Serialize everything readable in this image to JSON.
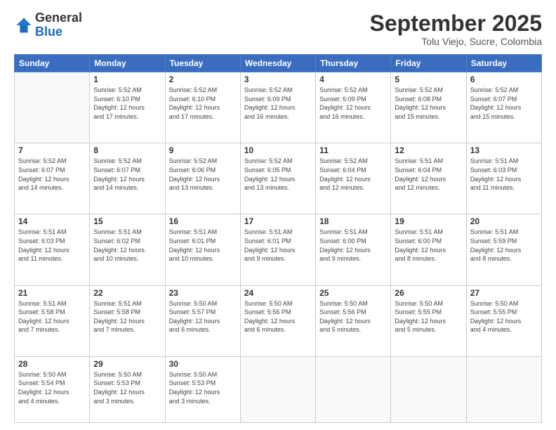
{
  "header": {
    "logo_general": "General",
    "logo_blue": "Blue",
    "month_title": "September 2025",
    "subtitle": "Tolu Viejo, Sucre, Colombia"
  },
  "weekdays": [
    "Sunday",
    "Monday",
    "Tuesday",
    "Wednesday",
    "Thursday",
    "Friday",
    "Saturday"
  ],
  "weeks": [
    [
      {
        "day": "",
        "info": ""
      },
      {
        "day": "1",
        "info": "Sunrise: 5:52 AM\nSunset: 6:10 PM\nDaylight: 12 hours\nand 17 minutes."
      },
      {
        "day": "2",
        "info": "Sunrise: 5:52 AM\nSunset: 6:10 PM\nDaylight: 12 hours\nand 17 minutes."
      },
      {
        "day": "3",
        "info": "Sunrise: 5:52 AM\nSunset: 6:09 PM\nDaylight: 12 hours\nand 16 minutes."
      },
      {
        "day": "4",
        "info": "Sunrise: 5:52 AM\nSunset: 6:09 PM\nDaylight: 12 hours\nand 16 minutes."
      },
      {
        "day": "5",
        "info": "Sunrise: 5:52 AM\nSunset: 6:08 PM\nDaylight: 12 hours\nand 15 minutes."
      },
      {
        "day": "6",
        "info": "Sunrise: 5:52 AM\nSunset: 6:07 PM\nDaylight: 12 hours\nand 15 minutes."
      }
    ],
    [
      {
        "day": "7",
        "info": ""
      },
      {
        "day": "8",
        "info": "Sunrise: 5:52 AM\nSunset: 6:07 PM\nDaylight: 12 hours\nand 14 minutes."
      },
      {
        "day": "9",
        "info": "Sunrise: 5:52 AM\nSunset: 6:06 PM\nDaylight: 12 hours\nand 13 minutes."
      },
      {
        "day": "10",
        "info": "Sunrise: 5:52 AM\nSunset: 6:05 PM\nDaylight: 12 hours\nand 13 minutes."
      },
      {
        "day": "11",
        "info": "Sunrise: 5:52 AM\nSunset: 6:04 PM\nDaylight: 12 hours\nand 12 minutes."
      },
      {
        "day": "12",
        "info": "Sunrise: 5:51 AM\nSunset: 6:04 PM\nDaylight: 12 hours\nand 12 minutes."
      },
      {
        "day": "13",
        "info": "Sunrise: 5:51 AM\nSunset: 6:03 PM\nDaylight: 12 hours\nand 11 minutes."
      }
    ],
    [
      {
        "day": "14",
        "info": ""
      },
      {
        "day": "15",
        "info": "Sunrise: 5:51 AM\nSunset: 6:02 PM\nDaylight: 12 hours\nand 10 minutes."
      },
      {
        "day": "16",
        "info": "Sunrise: 5:51 AM\nSunset: 6:01 PM\nDaylight: 12 hours\nand 10 minutes."
      },
      {
        "day": "17",
        "info": "Sunrise: 5:51 AM\nSunset: 6:01 PM\nDaylight: 12 hours\nand 9 minutes."
      },
      {
        "day": "18",
        "info": "Sunrise: 5:51 AM\nSunset: 6:00 PM\nDaylight: 12 hours\nand 9 minutes."
      },
      {
        "day": "19",
        "info": "Sunrise: 5:51 AM\nSunset: 6:00 PM\nDaylight: 12 hours\nand 8 minutes."
      },
      {
        "day": "20",
        "info": "Sunrise: 5:51 AM\nSunset: 5:59 PM\nDaylight: 12 hours\nand 8 minutes."
      }
    ],
    [
      {
        "day": "21",
        "info": ""
      },
      {
        "day": "22",
        "info": "Sunrise: 5:51 AM\nSunset: 5:58 PM\nDaylight: 12 hours\nand 7 minutes."
      },
      {
        "day": "23",
        "info": "Sunrise: 5:50 AM\nSunset: 5:57 PM\nDaylight: 12 hours\nand 6 minutes."
      },
      {
        "day": "24",
        "info": "Sunrise: 5:50 AM\nSunset: 5:56 PM\nDaylight: 12 hours\nand 6 minutes."
      },
      {
        "day": "25",
        "info": "Sunrise: 5:50 AM\nSunset: 5:56 PM\nDaylight: 12 hours\nand 5 minutes."
      },
      {
        "day": "26",
        "info": "Sunrise: 5:50 AM\nSunset: 5:55 PM\nDaylight: 12 hours\nand 5 minutes."
      },
      {
        "day": "27",
        "info": "Sunrise: 5:50 AM\nSunset: 5:55 PM\nDaylight: 12 hours\nand 4 minutes."
      }
    ],
    [
      {
        "day": "28",
        "info": "Sunrise: 5:50 AM\nSunset: 5:54 PM\nDaylight: 12 hours\nand 4 minutes."
      },
      {
        "day": "29",
        "info": "Sunrise: 5:50 AM\nSunset: 5:53 PM\nDaylight: 12 hours\nand 3 minutes."
      },
      {
        "day": "30",
        "info": "Sunrise: 5:50 AM\nSunset: 5:53 PM\nDaylight: 12 hours\nand 3 minutes."
      },
      {
        "day": "",
        "info": ""
      },
      {
        "day": "",
        "info": ""
      },
      {
        "day": "",
        "info": ""
      },
      {
        "day": "",
        "info": ""
      }
    ]
  ],
  "week7_sunday": {
    "day": "7",
    "info": "Sunrise: 5:52 AM\nSunset: 6:07 PM\nDaylight: 12 hours\nand 14 minutes."
  },
  "week14_sunday": {
    "day": "14",
    "info": "Sunrise: 5:51 AM\nSunset: 6:03 PM\nDaylight: 12 hours\nand 11 minutes."
  },
  "week21_sunday": {
    "day": "21",
    "info": "Sunrise: 5:51 AM\nSunset: 5:58 PM\nDaylight: 12 hours\nand 7 minutes."
  }
}
